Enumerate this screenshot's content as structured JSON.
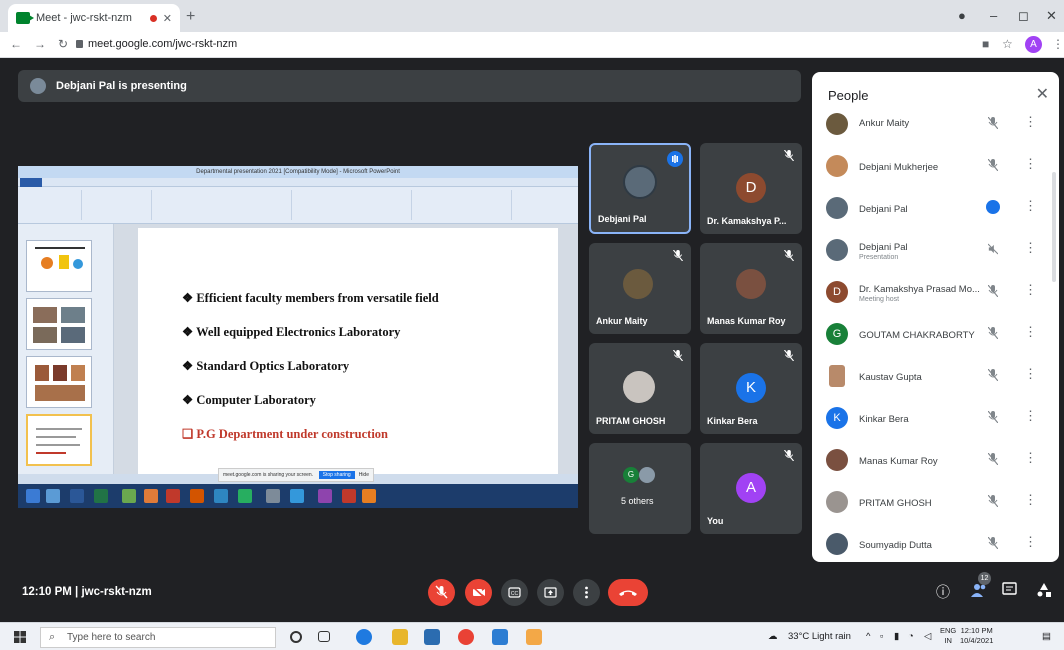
{
  "browser": {
    "tab_title": "Meet - jwc-rskt-nzm",
    "url": "meet.google.com/jwc-rskt-nzm",
    "profile_initial": "A"
  },
  "banner": {
    "text": "Debjani Pal is presenting"
  },
  "presentation": {
    "window_title": "Departmental presentation 2021 [Compatibility Mode] - Microsoft PowerPoint",
    "bullets": [
      "❖ Efficient faculty members from versatile field",
      "❖ Well equipped Electronics Laboratory",
      "❖ Standard Optics Laboratory",
      "❖ Computer Laboratory"
    ],
    "bullet_red": "❑ P.G Department under construction",
    "share_text": "meet.google.com is sharing your screen.",
    "stop_sharing": "Stop sharing",
    "hide": "Hide"
  },
  "tiles": [
    {
      "name": "Debjani Pal"
    },
    {
      "name": "Dr. Kamakshya P...",
      "initial": "D",
      "color": "#8d4a2f"
    },
    {
      "name": "Ankur Maity"
    },
    {
      "name": "Manas Kumar Roy"
    },
    {
      "name": "PRITAM GHOSH"
    },
    {
      "name": "Kinkar Bera",
      "initial": "K",
      "color": "#1a73e8"
    },
    {
      "name": "5 others",
      "initial": "G"
    },
    {
      "name": "You",
      "initial": "A",
      "color": "#a142f4"
    }
  ],
  "people": {
    "title": "People",
    "rows": [
      {
        "name": "Ankur Maity",
        "sub": ""
      },
      {
        "name": "Debjani Mukherjee",
        "sub": ""
      },
      {
        "name": "Debjani Pal",
        "sub": ""
      },
      {
        "name": "Debjani Pal",
        "sub": "Presentation"
      },
      {
        "name": "Dr. Kamakshya Prasad Mo...",
        "sub": "Meeting host",
        "initial": "D",
        "color": "#8d4a2f"
      },
      {
        "name": "GOUTAM CHAKRABORTY",
        "sub": "",
        "initial": "G",
        "color": "#188038"
      },
      {
        "name": "Kaustav Gupta",
        "sub": ""
      },
      {
        "name": "Kinkar Bera",
        "sub": "",
        "initial": "K",
        "color": "#1a73e8"
      },
      {
        "name": "Manas Kumar Roy",
        "sub": ""
      },
      {
        "name": "PRITAM GHOSH",
        "sub": ""
      },
      {
        "name": "Soumyadip Dutta",
        "sub": ""
      }
    ]
  },
  "meeting": {
    "info": "12:10 PM  |  jwc-rskt-nzm",
    "participants_count": "12"
  },
  "taskbar": {
    "search_placeholder": "Type here to search",
    "weather": "33°C  Light rain",
    "lang": "ENG",
    "region": "IN",
    "time": "12:10 PM",
    "date": "10/4/2021"
  },
  "colors": {
    "meet_bg": "#202124",
    "tile_bg": "#3c4043",
    "red": "#ea4335",
    "blue": "#1a73e8"
  }
}
